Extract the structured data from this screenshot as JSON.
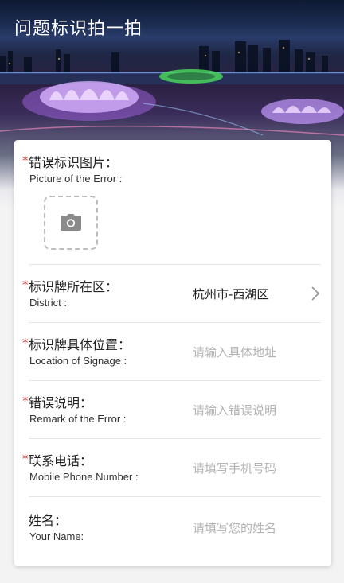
{
  "header": {
    "title": "问题标识拍一拍"
  },
  "form": {
    "fields": [
      {
        "required": true,
        "label_cn": "错误标识图片：",
        "label_en": "Picture of the Error :",
        "type": "photo-upload",
        "icon": "camera-icon"
      },
      {
        "required": true,
        "label_cn": "标识牌所在区：",
        "label_en": "District :",
        "value": "杭州市-西湖区",
        "type": "select",
        "icon": "chevron-right-icon"
      },
      {
        "required": true,
        "label_cn": "标识牌具体位置：",
        "label_en": "Location of Signage :",
        "placeholder": "请输入具体地址",
        "type": "input"
      },
      {
        "required": true,
        "label_cn": "错误说明：",
        "label_en": "Remark of the Error :",
        "placeholder": "请输入错误说明",
        "type": "input"
      },
      {
        "required": true,
        "label_cn": "联系电话：",
        "label_en": "Mobile Phone Number :",
        "placeholder": "请填写手机号码",
        "type": "input"
      },
      {
        "required": false,
        "label_cn": "姓名：",
        "label_en": "Your Name:",
        "placeholder": "请填写您的姓名",
        "type": "input"
      }
    ]
  },
  "colors": {
    "required_star": "#d8342b",
    "placeholder": "#b3b3b3",
    "text": "#222222"
  }
}
